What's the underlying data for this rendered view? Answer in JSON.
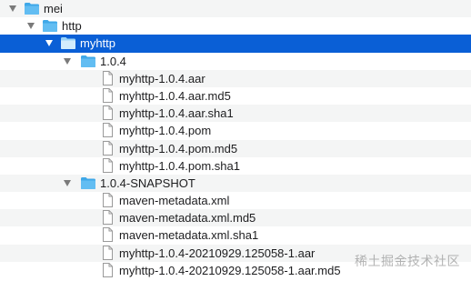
{
  "tree": {
    "rows": [
      {
        "label": "mei",
        "type": "folder",
        "expanded": true
      },
      {
        "label": "http",
        "type": "folder",
        "expanded": true
      },
      {
        "label": "myhttp",
        "type": "folder",
        "expanded": true,
        "selected": true
      },
      {
        "label": "1.0.4",
        "type": "folder",
        "expanded": true
      },
      {
        "label": "myhttp-1.0.4.aar",
        "type": "file"
      },
      {
        "label": "myhttp-1.0.4.aar.md5",
        "type": "file"
      },
      {
        "label": "myhttp-1.0.4.aar.sha1",
        "type": "file"
      },
      {
        "label": "myhttp-1.0.4.pom",
        "type": "file"
      },
      {
        "label": "myhttp-1.0.4.pom.md5",
        "type": "file"
      },
      {
        "label": "myhttp-1.0.4.pom.sha1",
        "type": "file"
      },
      {
        "label": "1.0.4-SNAPSHOT",
        "type": "folder",
        "expanded": true
      },
      {
        "label": "maven-metadata.xml",
        "type": "file"
      },
      {
        "label": "maven-metadata.xml.md5",
        "type": "file"
      },
      {
        "label": "maven-metadata.xml.sha1",
        "type": "file"
      },
      {
        "label": "myhttp-1.0.4-20210929.125058-1.aar",
        "type": "file"
      },
      {
        "label": "myhttp-1.0.4-20210929.125058-1.aar.md5",
        "type": "file"
      }
    ]
  },
  "watermark": "稀土掘金技术社区",
  "colors": {
    "selection": "#0a5fd6",
    "folder": "#3fa8e8",
    "stripe": "#f4f5f5"
  }
}
